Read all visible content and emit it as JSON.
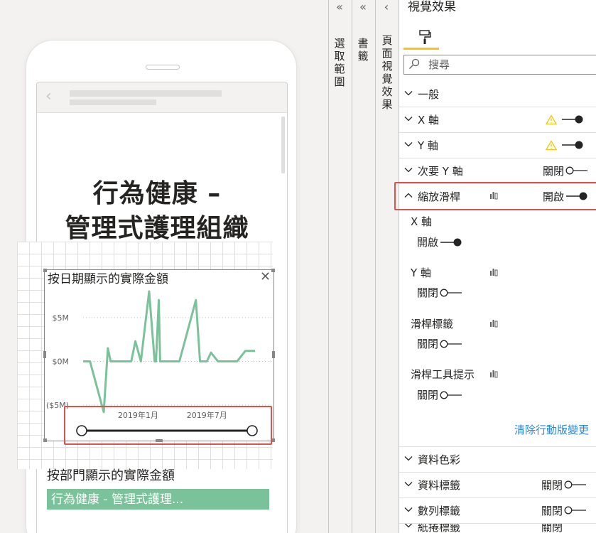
{
  "report": {
    "page_title_line1": "行為健康 –",
    "page_title_line2": "管理式護理組織",
    "chart": {
      "title": "按日期顯示的實際金額",
      "close_glyph": "✕"
    },
    "second_visual_title": "按部門顯示的實際金額",
    "table_first_row": "行為健康 - 管理式護理..."
  },
  "chart_data": {
    "type": "line",
    "title": "按日期顯示的實際金額",
    "y_tick_labels": [
      "$5M",
      "$0M",
      "($5M)"
    ],
    "y_ticks": [
      5,
      0,
      -5
    ],
    "ylim": [
      -5,
      8
    ],
    "x_tick_labels": [
      "2019年1月",
      "2019年7月"
    ],
    "x_ticks": [
      2019.0,
      2019.5
    ],
    "xlim": [
      2018.6,
      2019.85
    ],
    "grid": true,
    "series": [
      {
        "color": "#7ac29a",
        "x": [
          2018.6,
          2018.65,
          2018.75,
          2018.78,
          2018.8,
          2018.85,
          2018.9,
          2018.95,
          2018.98,
          2019.02,
          2019.08,
          2019.12,
          2019.13,
          2019.15,
          2019.16,
          2019.17,
          2019.2,
          2019.3,
          2019.42,
          2019.45,
          2019.47,
          2019.5,
          2019.53,
          2019.58,
          2019.63,
          2019.66,
          2019.72,
          2019.78,
          2019.85
        ],
        "y": [
          0.0,
          0.0,
          -5.8,
          1.5,
          0.0,
          0.0,
          0.0,
          0.0,
          2.3,
          0.0,
          8.0,
          0.0,
          0.0,
          7.0,
          0.0,
          0.0,
          0.0,
          0.0,
          7.0,
          0.0,
          0.0,
          0.0,
          1.0,
          0.0,
          0.0,
          0.0,
          0.0,
          1.2,
          1.2
        ]
      }
    ],
    "zoom_slider": {
      "start": 0.0,
      "end": 1.0
    }
  },
  "panes": {
    "filters": {
      "chevron": "«",
      "label": "選取範圍"
    },
    "bookmarks": {
      "chevron": "«",
      "label": "書籤"
    },
    "page_visuals": {
      "chevron": "‹",
      "label": "頁面視覺效果"
    }
  },
  "viz_pane": {
    "title": "視覺效果",
    "search_placeholder": "搜尋",
    "sections": [
      {
        "label": "一般"
      },
      {
        "label": "X 軸",
        "warning": true,
        "toggle_on": true
      },
      {
        "label": "Y 軸",
        "warning": true,
        "toggle_on": true
      },
      {
        "label": "次要 Y 軸",
        "state": "關閉",
        "toggle_on": false
      },
      {
        "label": "縮放滑桿",
        "state": "開啟",
        "toggle_on": true,
        "expanded": true
      }
    ],
    "zoom_options": [
      {
        "label": "X 軸",
        "state": "開啟",
        "toggle_on": true
      },
      {
        "label": "Y 軸",
        "state": "關閉",
        "toggle_on": false
      },
      {
        "label": "滑桿標籤",
        "state": "關閉",
        "toggle_on": false
      },
      {
        "label": "滑桿工具提示",
        "state": "關閉",
        "toggle_on": false
      }
    ],
    "reset_link": "清除行動版變更",
    "lower_sections": [
      {
        "label": "資料色彩"
      },
      {
        "label": "資料標籤",
        "state": "關閉",
        "toggle_on": false
      },
      {
        "label": "數列標籤",
        "state": "關閉",
        "toggle_on": false
      },
      {
        "label": "紙捲標籤",
        "state": "關閉",
        "toggle_on": false
      }
    ]
  },
  "colors": {
    "line": "#7ac29a",
    "highlight": "#d9534f",
    "accent_tab": "#f2c811",
    "link": "#2b88d8",
    "warning": "#f2c811"
  }
}
